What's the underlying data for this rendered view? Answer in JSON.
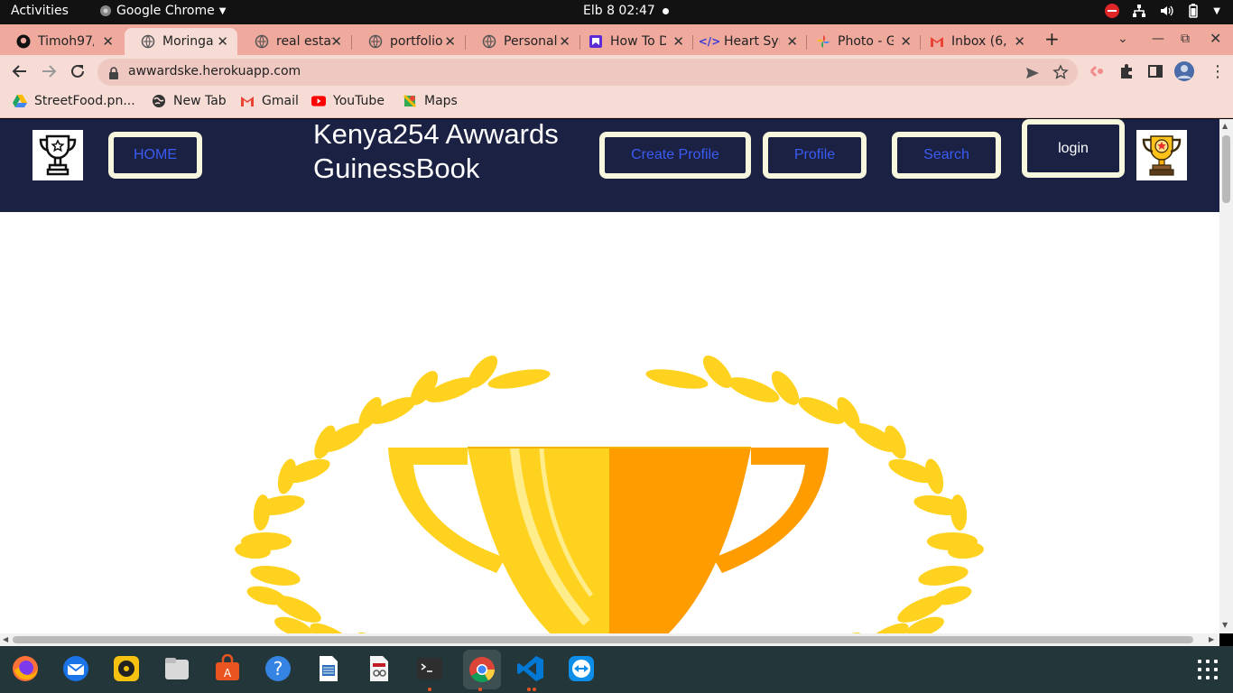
{
  "system": {
    "activities": "Activities",
    "app_name": "Google Chrome",
    "clock": "Elb 8  02:47"
  },
  "tabs": [
    {
      "title": "Timoh97/",
      "icon": "github-icon"
    },
    {
      "title": "Moringa",
      "icon": "globe-icon",
      "active": true
    },
    {
      "title": "real estat",
      "icon": "globe-icon"
    },
    {
      "title": "portfolio",
      "icon": "globe-icon"
    },
    {
      "title": "Personal",
      "icon": "globe-icon"
    },
    {
      "title": "How To D",
      "icon": "bookmark-icon"
    },
    {
      "title": "Heart Syr",
      "icon": "code-icon"
    },
    {
      "title": "Photo - G",
      "icon": "pinwheel-icon"
    },
    {
      "title": "Inbox (6,",
      "icon": "gmail-icon"
    }
  ],
  "toolbar": {
    "url": "awwardske.herokuapp.com"
  },
  "bookmarks": [
    {
      "label": "StreetFood.pn...",
      "icon": "drive-icon"
    },
    {
      "label": "New Tab",
      "icon": "globe-icon"
    },
    {
      "label": "Gmail",
      "icon": "gmail-icon"
    },
    {
      "label": "YouTube",
      "icon": "youtube-icon"
    },
    {
      "label": "Maps",
      "icon": "maps-icon"
    }
  ],
  "site": {
    "brand": "Kenya254 Awwards GuinessBook",
    "nav": {
      "home": "HOME",
      "create_profile": "Create Profile",
      "profile": "Profile",
      "search": "Search",
      "login": "login"
    }
  },
  "colors": {
    "nav_bg": "#1b2142",
    "button_border": "#f6f7dc",
    "link_blue": "#3b5bf5",
    "tab_strip": "#efa99d",
    "toolbar": "#f7dcd6",
    "trophy_gold": "#ffd200",
    "trophy_orange": "#ff9d00"
  },
  "dock": [
    {
      "name": "firefox-icon"
    },
    {
      "name": "thunderbird-icon"
    },
    {
      "name": "rhythmbox-icon"
    },
    {
      "name": "files-icon"
    },
    {
      "name": "software-icon"
    },
    {
      "name": "help-icon"
    },
    {
      "name": "writer-icon"
    },
    {
      "name": "document-viewer-icon"
    },
    {
      "name": "terminal-icon",
      "running": true
    },
    {
      "name": "chrome-icon",
      "running": true
    },
    {
      "name": "vscode-icon",
      "running": true
    },
    {
      "name": "teamviewer-icon"
    }
  ]
}
